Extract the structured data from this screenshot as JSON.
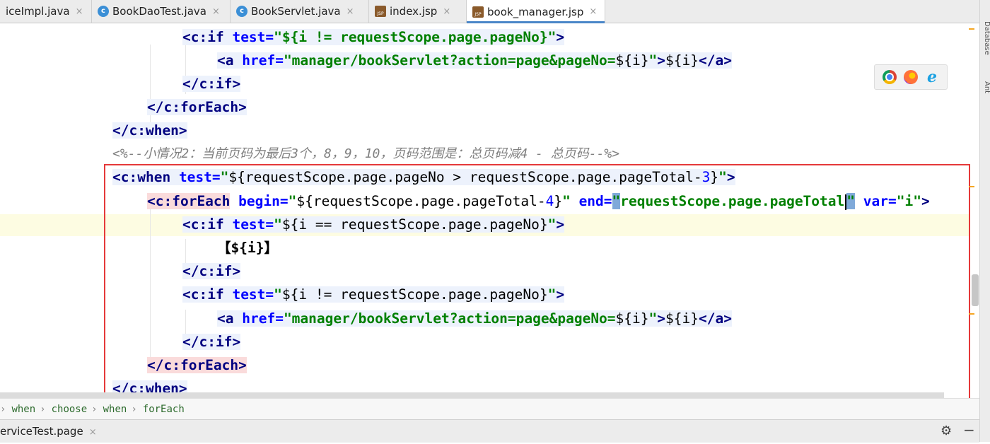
{
  "tabs": [
    {
      "label": "iceImpl.java",
      "type": "java",
      "icon": ""
    },
    {
      "label": "BookDaoTest.java",
      "type": "java",
      "icon": "java-class-icon"
    },
    {
      "label": "BookServlet.java",
      "type": "java",
      "icon": "java-class-icon"
    },
    {
      "label": "index.jsp",
      "type": "jsp",
      "icon": "jsp-file-icon"
    },
    {
      "label": "book_manager.jsp",
      "type": "jsp",
      "icon": "jsp-file-icon",
      "active": true
    }
  ],
  "close_glyph": "×",
  "code": {
    "l1": {
      "open": "<c:if",
      "attr": "test=",
      "val": "\"${i != requestScope.page.pageNo}\"",
      "close": ">"
    },
    "l2": {
      "open": "<a",
      "attr": "href=",
      "val": "\"manager/bookServlet?action=page&pageNo=",
      "el": "${i}",
      "valend": "\"",
      "mid": ">",
      "el2": "${i}",
      "close": "</a>"
    },
    "l3": "</c:if>",
    "l4": "</c:forEach>",
    "l5": "</c:when>",
    "l6": "<%--小情况2：当前页码为最后3个，8，9，10，页码范围是：总页码减4 - 总页码--%>",
    "l7": {
      "open": "<c:when",
      "attr": "test=",
      "q1": "\"",
      "el": "${requestScope.page.pageNo > requestScope.page.pageTotal-",
      "num": "3",
      "elend": "}",
      "q2": "\"",
      "close": ">"
    },
    "l8": {
      "open": "<c:forEach",
      "attr1": "begin=",
      "q1": "\"",
      "el": "${requestScope.page.pageTotal-",
      "num": "4",
      "elend": "}",
      "q2": "\"",
      "attr2": "end=",
      "q3": "\"",
      "val": "requestScope.page.pageTotal",
      "q4": "\"",
      "attr3": "var=",
      "val3": "\"i\"",
      "close": ">"
    },
    "l9": {
      "open": "<c:if",
      "attr": "test=",
      "q1": "\"",
      "el": "${i == requestScope.page.pageNo}",
      "q2": "\"",
      "close": ">"
    },
    "l10": "【${i}】",
    "l11": "</c:if>",
    "l12": {
      "open": "<c:if",
      "attr": "test=",
      "q1": "\"",
      "el": "${i != requestScope.page.pageNo}",
      "q2": "\"",
      "close": ">"
    },
    "l13": {
      "open": "<a",
      "attr": "href=",
      "val": "\"manager/bookServlet?action=page&pageNo=",
      "el": "${i}",
      "valend": "\"",
      "mid": ">",
      "el2": "${i}",
      "close": "</a>"
    },
    "l14": "</c:if>",
    "l15": "</c:forEach>",
    "l16": "</c:when>"
  },
  "breadcrumb": [
    "when",
    "choose",
    "when",
    "forEach"
  ],
  "breadcrumb_sep": "›",
  "run_tab": "erviceTest.page",
  "right_labels": [
    "Database",
    "Ant"
  ],
  "browsers": [
    "chrome-icon",
    "firefox-icon",
    "ie-icon"
  ],
  "ie_glyph": "e",
  "gear_glyph": "⚙",
  "minus_glyph": "−",
  "colors": {
    "highlight_box": "#e5393a",
    "active_tab_underline": "#4a86c8"
  }
}
